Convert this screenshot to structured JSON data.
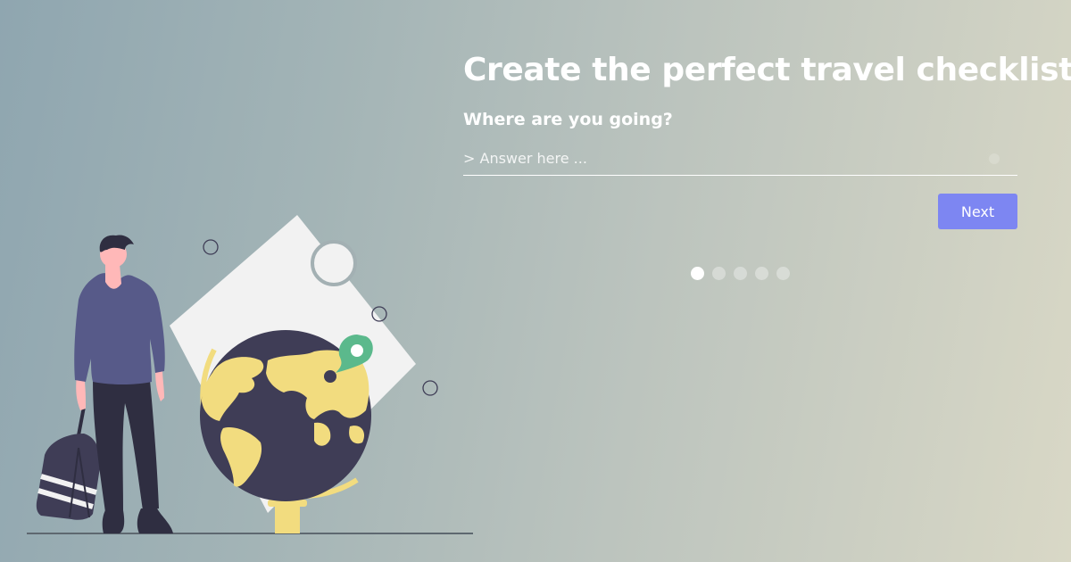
{
  "form": {
    "headline": "Create the perfect travel checklist",
    "question": "Where are you going?",
    "answer_value": "",
    "answer_placeholder": "> Answer here ...",
    "next_label": "Next"
  },
  "progress": {
    "total_steps": 5,
    "current_step": 1
  },
  "colors": {
    "button": "#7d86f2",
    "text": "#ffffff",
    "globe": "#3f3d56",
    "continents": "#f2dc7f",
    "pin": "#5bb98c",
    "shirt": "#575a89"
  }
}
